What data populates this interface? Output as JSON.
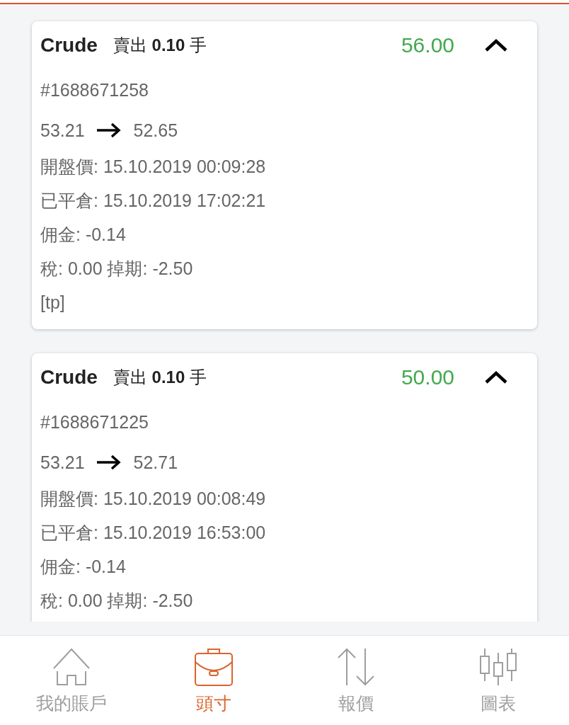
{
  "positions": [
    {
      "symbol": "Crude",
      "side": "賣出 **0.10** 手",
      "profit": "56.00",
      "expanded": true,
      "ticket": "#1688671258",
      "open_price": "53.21",
      "close_price": "52.65",
      "details": [
        "開盤價: 15.10.2019 00:09:28",
        "已平倉: 15.10.2019 17:02:21",
        "佣金: -0.14",
        "稅: 0.00 掉期: -2.50"
      ],
      "comment": "[tp]"
    },
    {
      "symbol": "Crude",
      "side": "賣出 **0.10** 手",
      "profit": "50.00",
      "expanded": true,
      "ticket": "#1688671225",
      "open_price": "53.21",
      "close_price": "52.71",
      "details": [
        "開盤價: 15.10.2019 00:08:49",
        "已平倉: 15.10.2019 16:53:00",
        "佣金: -0.14",
        "稅: 0.00 掉期: -2.50"
      ]
    }
  ],
  "bottom_nav": [
    {
      "label": "我的賬戶",
      "selected": false
    },
    {
      "label": "頭寸",
      "selected": true
    },
    {
      "label": "報價",
      "selected": false
    },
    {
      "label": "圖表",
      "selected": false
    }
  ]
}
